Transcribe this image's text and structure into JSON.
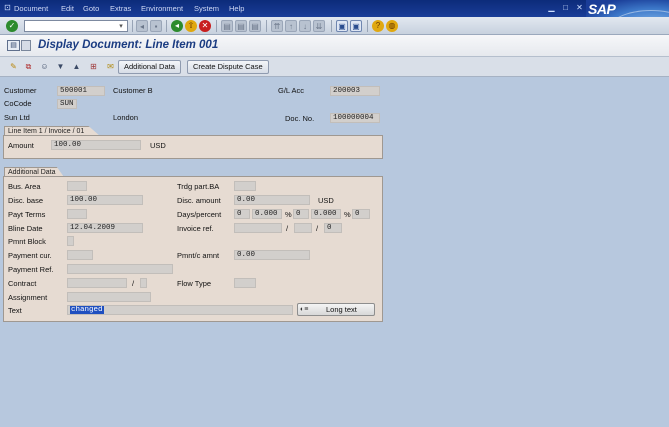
{
  "menu": {
    "items": [
      "Document",
      "Edit",
      "Goto",
      "Extras",
      "Environment",
      "System",
      "Help"
    ],
    "logo": "SAP"
  },
  "title": "Display Document: Line Item 001",
  "app_toolbar": {
    "additional_data": "Additional Data",
    "create_dispute_case": "Create Dispute Case"
  },
  "header": {
    "customer_label": "Customer",
    "customer_value": "500001",
    "customer_name": "Customer B",
    "glacc_label": "G/L Acc",
    "glacc_value": "200003",
    "cocode_label": "CoCode",
    "cocode_value": "SUN",
    "company_name": "Sun Ltd",
    "city": "London",
    "docno_label": "Doc. No.",
    "docno_value": "100000004"
  },
  "line_item": {
    "tab": "Line Item 1 / Invoice / 01",
    "amount_label": "Amount",
    "amount_value": "100.00",
    "currency": "USD"
  },
  "additional_data": {
    "tab": "Additional Data",
    "bus_area_label": "Bus. Area",
    "bus_area_value": "",
    "trdg_part_label": "Trdg part.BA",
    "trdg_part_value": "",
    "disc_base_label": "Disc. base",
    "disc_base_value": "100.00",
    "disc_amount_label": "Disc. amount",
    "disc_amount_value": "0.00",
    "disc_currency": "USD",
    "payt_terms_label": "Payt Terms",
    "payt_terms_value": "",
    "days_percent_label": "Days/percent",
    "days1": "0",
    "pct1": "0.000",
    "pct_sign1": "%",
    "days2": "0",
    "pct2": "0.000",
    "pct_sign2": "%",
    "days3": "0",
    "bline_date_label": "Bline Date",
    "bline_date_value": "12.04.2009",
    "invoice_ref_label": "Invoice ref.",
    "invoice_ref_value": "",
    "invoice_ref_sep1": "/",
    "invoice_ref_sep2": "/",
    "invoice_ref_item": "0",
    "pmnt_block_label": "Pmnt Block",
    "payment_cur_label": "Payment cur.",
    "payment_cur_value": "",
    "pmnt_amnt_label": "Pmnt/c amnt",
    "pmnt_amnt_value": "0.00",
    "payment_ref_label": "Payment Ref.",
    "payment_ref_value": "",
    "contract_label": "Contract",
    "contract_sep": "/",
    "flow_type_label": "Flow Type",
    "assignment_label": "Assignment",
    "assignment_value": "",
    "text_label": "Text",
    "text_value": "changed",
    "long_text_button": "Long text"
  }
}
